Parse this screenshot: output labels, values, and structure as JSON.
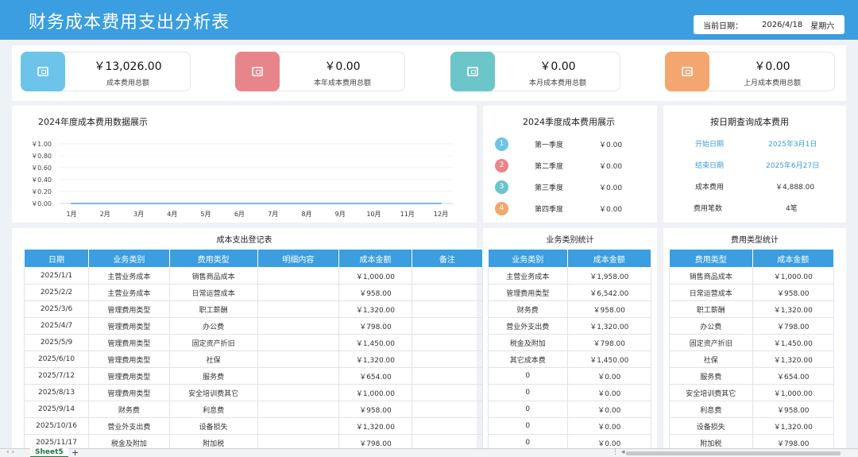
{
  "header": {
    "title": "财务成本费用支出分析表",
    "date_label": "当前日期：",
    "date": "2026/4/18",
    "weekday": "星期六"
  },
  "kpis": [
    {
      "value": "￥13,026.00",
      "caption": "成本费用总额",
      "color": "#6cc4ea",
      "icon": "receipt-icon"
    },
    {
      "value": "￥0.00",
      "caption": "本年成本费用总额",
      "color": "#e8858b",
      "icon": "receipt-icon"
    },
    {
      "value": "￥0.00",
      "caption": "本月成本费用总额",
      "color": "#6cc5c8",
      "icon": "receipt-icon"
    },
    {
      "value": "￥0.00",
      "caption": "上月成本费用总额",
      "color": "#f3a66e",
      "icon": "receipt-icon"
    }
  ],
  "chart_data": {
    "type": "line",
    "title": "2024年度成本费用数据展示",
    "categories": [
      "1月",
      "2月",
      "3月",
      "4月",
      "5月",
      "6月",
      "7月",
      "8月",
      "9月",
      "10月",
      "11月",
      "12月"
    ],
    "values": [
      0,
      0,
      0,
      0,
      0,
      0,
      0,
      0,
      0,
      0,
      0,
      0
    ],
    "ylim": [
      0,
      1
    ],
    "yticks": [
      "￥0.00",
      "￥0.20",
      "￥0.40",
      "￥0.60",
      "￥0.80",
      "￥1.00"
    ],
    "grid": true,
    "line_color": "#7fb5e6",
    "xlabel": "",
    "ylabel": ""
  },
  "quarters": {
    "title": "2024季度成本费用展示",
    "items": [
      {
        "num": "1",
        "label": "第一季度",
        "value": "￥0.00",
        "color": "#6cc4ea"
      },
      {
        "num": "2",
        "label": "第二季度",
        "value": "￥0.00",
        "color": "#e8858b"
      },
      {
        "num": "3",
        "label": "第三季度",
        "value": "￥0.00",
        "color": "#6cc5c8"
      },
      {
        "num": "4",
        "label": "第四季度",
        "value": "￥0.00",
        "color": "#f3a66e"
      }
    ]
  },
  "query": {
    "title": "按日期查询成本费用",
    "start_label": "开始日期",
    "start_value": "2025年3月1日",
    "end_label": "结束日期",
    "end_value": "2025年6月27日",
    "cost_label": "成本费用",
    "cost_value": "￥4,888.00",
    "count_label": "费用笔数",
    "count_value": "4笔"
  },
  "register": {
    "title": "成本支出登记表",
    "headers": [
      "日期",
      "业务类别",
      "费用类型",
      "明细内容",
      "成本金额",
      "备注"
    ],
    "rows": [
      [
        "2025/1/1",
        "主营业务成本",
        "销售商品成本",
        "",
        "￥1,000.00",
        ""
      ],
      [
        "2025/2/2",
        "主营业务成本",
        "日常运营成本",
        "",
        "￥958.00",
        ""
      ],
      [
        "2025/3/6",
        "管理费用类型",
        "职工薪酬",
        "",
        "￥1,320.00",
        ""
      ],
      [
        "2025/4/7",
        "管理费用类型",
        "办公费",
        "",
        "￥798.00",
        ""
      ],
      [
        "2025/5/9",
        "管理费用类型",
        "固定资产折旧",
        "",
        "￥1,450.00",
        ""
      ],
      [
        "2025/6/10",
        "管理费用类型",
        "社保",
        "",
        "￥1,320.00",
        ""
      ],
      [
        "2025/7/12",
        "管理费用类型",
        "服务费",
        "",
        "￥654.00",
        ""
      ],
      [
        "2025/8/13",
        "管理费用类型",
        "安全培训费其它",
        "",
        "￥1,000.00",
        ""
      ],
      [
        "2025/9/14",
        "财务费",
        "利息费",
        "",
        "￥958.00",
        ""
      ],
      [
        "2025/10/16",
        "营业外支出费",
        "设备损失",
        "",
        "￥1,320.00",
        ""
      ],
      [
        "2025/11/17",
        "税金及附加",
        "附加税",
        "",
        "￥798.00",
        ""
      ]
    ]
  },
  "business": {
    "title": "业务类别统计",
    "headers": [
      "业务类别",
      "成本金额"
    ],
    "rows": [
      [
        "主营业务成本",
        "￥1,958.00"
      ],
      [
        "管理费用类型",
        "￥6,542.00"
      ],
      [
        "财务费",
        "￥958.00"
      ],
      [
        "营业外支出费",
        "￥1,320.00"
      ],
      [
        "税金及附加",
        "￥798.00"
      ],
      [
        "其它成本费",
        "￥1,450.00"
      ],
      [
        "0",
        "￥0.00"
      ],
      [
        "0",
        "￥0.00"
      ],
      [
        "0",
        "￥0.00"
      ],
      [
        "0",
        "￥0.00"
      ],
      [
        "0",
        "￥0.00"
      ]
    ]
  },
  "expense": {
    "title": "费用类型统计",
    "headers": [
      "费用类型",
      "成本金额"
    ],
    "rows": [
      [
        "销售商品成本",
        "￥1,000.00"
      ],
      [
        "日常运营成本",
        "￥958.00"
      ],
      [
        "职工薪酬",
        "￥1,320.00"
      ],
      [
        "办公费",
        "￥798.00"
      ],
      [
        "固定资产折旧",
        "￥1,450.00"
      ],
      [
        "社保",
        "￥1,320.00"
      ],
      [
        "服务费",
        "￥654.00"
      ],
      [
        "安全培训费其它",
        "￥1,000.00"
      ],
      [
        "利息费",
        "￥958.00"
      ],
      [
        "设备损失",
        "￥1,320.00"
      ],
      [
        "附加税",
        "￥798.00"
      ]
    ]
  },
  "statusbar": {
    "nav": "‹  ›",
    "sheet_tab": "Sheet5",
    "add": "+",
    "dots": "⋮  ◂"
  }
}
